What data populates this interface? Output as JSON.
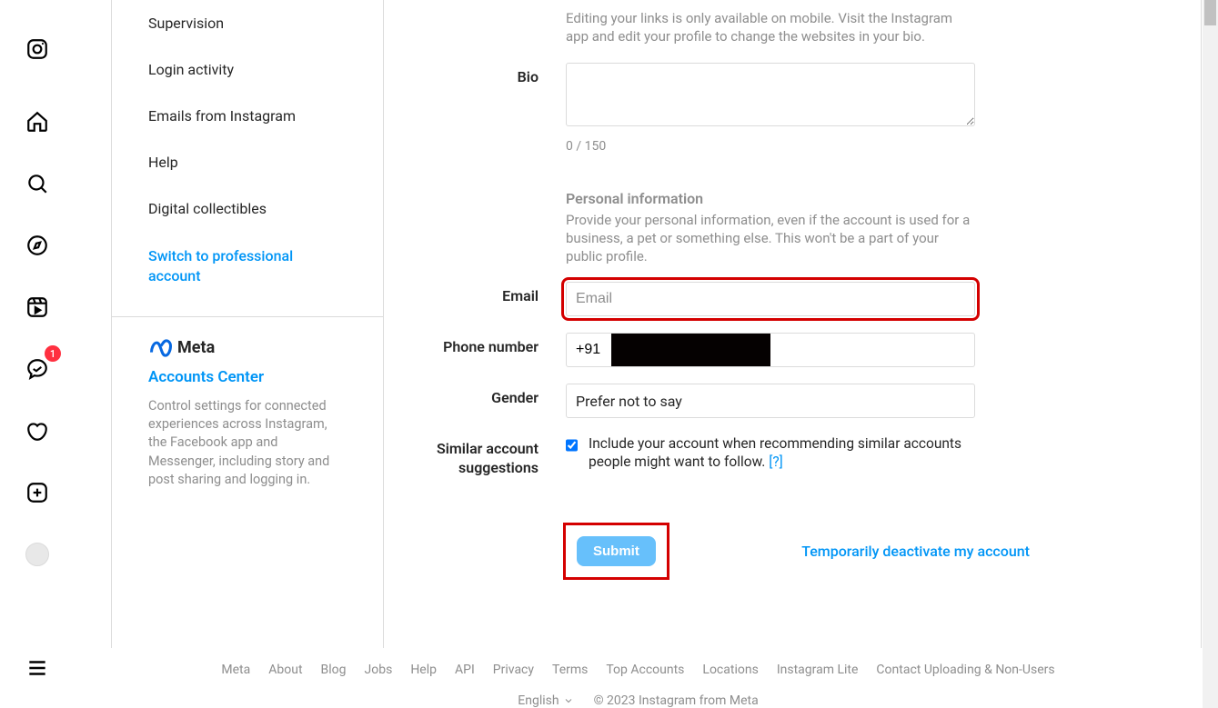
{
  "nav": {
    "messages_badge": "1"
  },
  "sidebar": {
    "links": {
      "supervision": "Supervision",
      "login_activity": "Login activity",
      "emails": "Emails from Instagram",
      "help": "Help",
      "collectibles": "Digital collectibles",
      "pro": "Switch to professional account"
    },
    "meta": {
      "brand": "Meta",
      "accounts_center": "Accounts Center",
      "desc": "Control settings for connected experiences across Instagram, the Facebook app and Messenger, including story and post sharing and logging in."
    }
  },
  "main": {
    "links_help": "Editing your links is only available on mobile. Visit the Instagram app and edit your profile to change the websites in your bio.",
    "bio_label": "Bio",
    "bio_value": "",
    "bio_count": "0 / 150",
    "personal": {
      "title": "Personal information",
      "desc": "Provide your personal information, even if the account is used for a business, a pet or something else. This won't be a part of your public profile."
    },
    "email_label": "Email",
    "email_placeholder": "Email",
    "email_value": "",
    "phone_label": "Phone number",
    "phone_value": "+91",
    "gender_label": "Gender",
    "gender_value": "Prefer not to say",
    "suggest_label": "Similar account suggestions",
    "suggest_text": "Include your account when recommending similar accounts people might want to follow.  ",
    "suggest_help": "[?]",
    "submit": "Submit",
    "deactivate": "Temporarily deactivate my account"
  },
  "footer": {
    "links": [
      "Meta",
      "About",
      "Blog",
      "Jobs",
      "Help",
      "API",
      "Privacy",
      "Terms",
      "Top Accounts",
      "Locations",
      "Instagram Lite",
      "Contact Uploading & Non-Users"
    ],
    "language": "English",
    "copyright": "© 2023 Instagram from Meta"
  }
}
